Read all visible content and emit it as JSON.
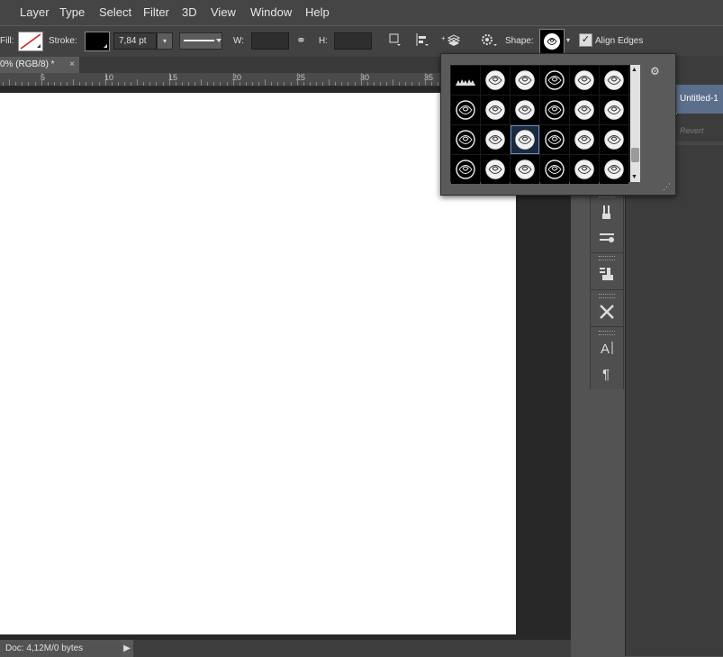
{
  "menu": [
    "Layer",
    "Type",
    "Select",
    "Filter",
    "3D",
    "View",
    "Window",
    "Help"
  ],
  "options": {
    "fill_label": "Fill:",
    "stroke_label": "Stroke:",
    "stroke_width": "7,84 pt",
    "w_label": "W:",
    "h_label": "H:",
    "shape_label": "Shape:",
    "align_edges_label": "Align Edges",
    "align_edges_checked": "✓"
  },
  "document": {
    "tab_title": "0% (RGB/8) *",
    "tab_close": "×"
  },
  "ruler": {
    "numbers": [
      "5",
      "10",
      "15",
      "20",
      "25",
      "30",
      "35"
    ]
  },
  "history": {
    "snapshot_label": "Untitled-1",
    "revert_label": "Revert"
  },
  "status": {
    "doc_info": "Doc: 4,12M/0 bytes",
    "arrow": "▶"
  },
  "colors": {
    "accent_selected": "#5b6e8c",
    "canvas": "#ffffff",
    "stroke_swatch": "#000000"
  },
  "icons": {
    "link": "link-icon",
    "gear": "gear-icon",
    "shape_preview": "rose-shape-icon"
  }
}
